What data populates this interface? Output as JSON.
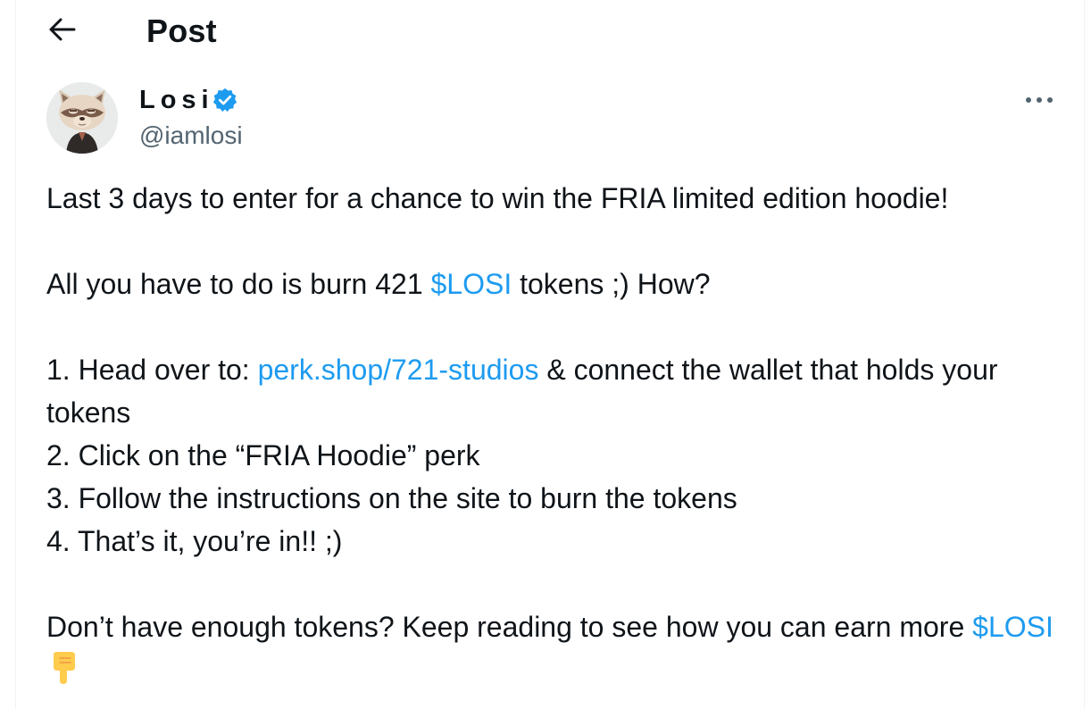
{
  "header": {
    "back_icon": "arrow-left-icon",
    "title": "Post"
  },
  "author": {
    "display_name": "Losi",
    "handle": "@iamlosi",
    "verified_icon": "verified-badge-icon",
    "avatar": "raccoon-avatar"
  },
  "more_icon": "more-horizontal-icon",
  "tweet": {
    "line1": "Last 3 days to enter for a chance to win the FRIA limited edition hoodie!",
    "line2_pre": "All you have to do is burn 421 ",
    "line2_link": "$LOSI",
    "line2_post": " tokens ;) How?",
    "step1_pre": "1. Head over to: ",
    "step1_link": "perk.shop/721-studios",
    "step1_post": " & connect the wallet that holds your tokens",
    "step2": "2. Click on the “FRIA Hoodie” perk",
    "step3": "3. Follow the instructions on the site to burn the tokens",
    "step4": "4. That’s it, you’re in!! ;)",
    "closing_pre": "Don’t have enough tokens? Keep reading to see how you can earn more ",
    "closing_link": "$LOSI",
    "closing_emoji": "pointing-down-hand-icon"
  },
  "colors": {
    "link": "#1d9bf0",
    "text": "#0f1419",
    "secondary": "#536471",
    "verified": "#1d9bf0",
    "emoji": "#ffcc4d"
  }
}
